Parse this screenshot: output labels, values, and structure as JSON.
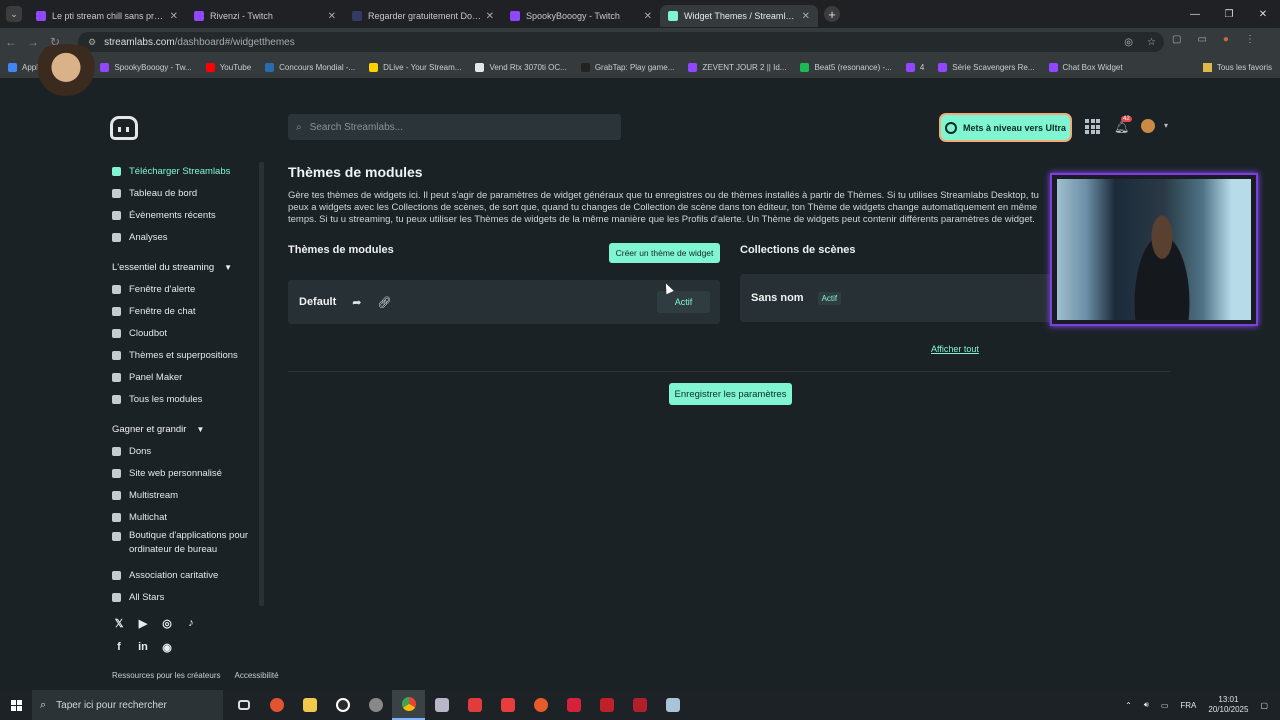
{
  "browser": {
    "tabs": [
      {
        "title": "Le pti stream chill sans prograi",
        "color": "#9146ff",
        "active": false
      },
      {
        "title": "Rivenzi - Twitch",
        "color": "#9146ff",
        "active": false
      },
      {
        "title": "Regarder gratuitement Dororo",
        "color": "#333a66",
        "active": false
      },
      {
        "title": "SpookyBooogy - Twitch",
        "color": "#9146ff",
        "active": false
      },
      {
        "title": "Widget Themes / Streamlabs",
        "color": "#80f5d2",
        "active": true
      }
    ],
    "url_host": "streamlabs.com",
    "url_path": "/dashboard#/widgetthemes",
    "bookmarks": [
      {
        "label": "Appl",
        "color": "#4285f4"
      },
      {
        "label": "ernier",
        "color": "#1877f2"
      },
      {
        "label": "SpookyBooogy - Tw...",
        "color": "#9146ff"
      },
      {
        "label": "YouTube",
        "color": "#ff0000"
      },
      {
        "label": "Concours Mondial -...",
        "color": "#2a6bb0"
      },
      {
        "label": "DLive - Your Stream...",
        "color": "#ffd300"
      },
      {
        "label": "Vend Rtx 3070ti OC...",
        "color": "#e6e6e6"
      },
      {
        "label": "GrabTap: Play game...",
        "color": "#222222"
      },
      {
        "label": "ZEVENT JOUR 2 || Id...",
        "color": "#9146ff"
      },
      {
        "label": "Beat5 (resonance) -...",
        "color": "#1db954"
      },
      {
        "label": "4",
        "color": "#9146ff"
      },
      {
        "label": "Série Scavengers Re...",
        "color": "#9146ff"
      },
      {
        "label": "Chat Box Widget",
        "color": "#9146ff"
      }
    ],
    "bookmarks_right": "Tous les favoris"
  },
  "header": {
    "search_placeholder": "Search Streamlabs...",
    "upgrade_label": "Mets à niveau vers Ultra",
    "notification_count": "42"
  },
  "sidebar": {
    "top_items": [
      {
        "label": "Télécharger Streamlabs",
        "highlight": true
      },
      {
        "label": "Tableau de bord",
        "highlight": false
      },
      {
        "label": "Évènements récents",
        "highlight": false
      },
      {
        "label": "Analyses",
        "highlight": false
      }
    ],
    "section1_title": "L'essentiel du streaming",
    "section1_items": [
      "Fenêtre d'alerte",
      "Fenêtre de chat",
      "Cloudbot",
      "Thèmes et superpositions",
      "Panel Maker",
      "Tous les modules"
    ],
    "section2_title": "Gagner et grandir",
    "section2_items": [
      "Dons",
      "Site web personnalisé",
      "Multistream",
      "Multichat"
    ],
    "section2_multiline": "Boutique d'applications pour ordinateur de bureau",
    "section2_items_after": [
      "Association caritative",
      "All Stars"
    ],
    "footer_links": [
      "Ressources pour les créateurs",
      "Accessibilité"
    ]
  },
  "main": {
    "page_title": "Thèmes de modules",
    "description": "Gère tes thèmes de widgets ici. Il peut s'agir de paramètres de widget généraux que tu enregistres ou de thèmes installés à partir de Thèmes. Si tu utilises Streamlabs Desktop, tu peux a widgets avec les Collections de scènes, de sort que, quand tu changes de Collection de scène dans ton éditeur, ton Thème de widgets change automatiquement en même temps. Si tu u streaming, tu peux utiliser les Thèmes de widgets de la même manière que les Profils d'alerte. Un Thème de widgets peut contenir différents paramètres de widget.",
    "themes_title": "Thèmes de modules",
    "create_button": "Créer un thème de widget",
    "theme_name": "Default",
    "theme_status": "Actif",
    "scenes_title": "Collections de scènes",
    "scene_name": "Sans nom",
    "scene_badge": "Actif",
    "show_all": "Afficher tout",
    "save_button": "Enregistrer les paramètres"
  },
  "taskbar": {
    "search_placeholder": "Taper ici pour rechercher",
    "language": "FRA",
    "time": "13:01",
    "date": "20/10/2025"
  }
}
